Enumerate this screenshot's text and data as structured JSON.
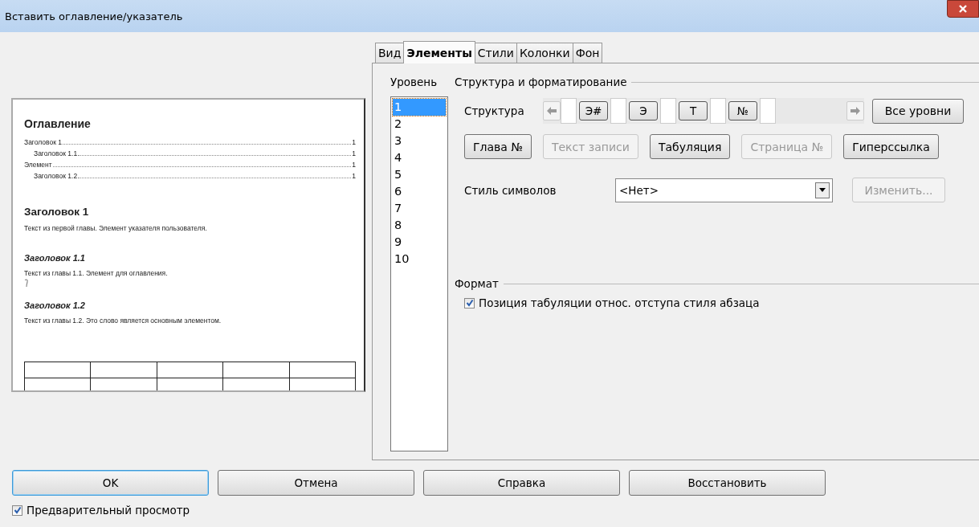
{
  "window": {
    "title": "Вставить оглавление/указатель"
  },
  "preview": {
    "toc_title": "Оглавление",
    "toc_entries": [
      {
        "text": "Заголовок 1",
        "page": "1",
        "children": [
          {
            "text": "Заголовок 1.1",
            "page": "1"
          }
        ]
      },
      {
        "text": "Элемент",
        "page": "1",
        "children": [
          {
            "text": "Заголовок 1.2",
            "page": "1"
          }
        ]
      }
    ],
    "blocks": [
      {
        "kind": "h1",
        "text": "Заголовок 1"
      },
      {
        "kind": "p",
        "text": "Текст из первой главы. Элемент указателя пользователя."
      },
      {
        "kind": "h2",
        "text": "Заголовок 1.1"
      },
      {
        "kind": "p",
        "text": "Текст из главы 1.1. Элемент для оглавления."
      },
      {
        "kind": "mark"
      },
      {
        "kind": "h2",
        "text": "Заголовок 1.2"
      },
      {
        "kind": "p",
        "text": "Текст из главы 1.2. Это слово является основным элементом."
      },
      {
        "kind": "table"
      }
    ]
  },
  "tabs": [
    {
      "label": "Вид",
      "selected": false
    },
    {
      "label": "Элементы",
      "selected": true
    },
    {
      "label": "Стили",
      "selected": false
    },
    {
      "label": "Колонки",
      "selected": false
    },
    {
      "label": "Фон",
      "selected": false
    }
  ],
  "level": {
    "label": "Уровень",
    "items": [
      {
        "label": "1",
        "selected": true
      },
      {
        "label": "2",
        "selected": false
      },
      {
        "label": "3",
        "selected": false
      },
      {
        "label": "4",
        "selected": false
      },
      {
        "label": "5",
        "selected": false
      },
      {
        "label": "6",
        "selected": false
      },
      {
        "label": "7",
        "selected": false
      },
      {
        "label": "8",
        "selected": false
      },
      {
        "label": "9",
        "selected": false
      },
      {
        "label": "10",
        "selected": false
      }
    ]
  },
  "structure": {
    "title": "Структура и форматирование",
    "label": "Структура",
    "tokens": [
      {
        "kind": "slot"
      },
      {
        "kind": "token",
        "text": "Э#"
      },
      {
        "kind": "slot"
      },
      {
        "kind": "token",
        "text": "Э"
      },
      {
        "kind": "slot"
      },
      {
        "kind": "token",
        "text": "Т"
      },
      {
        "kind": "slot"
      },
      {
        "kind": "token",
        "text": "№"
      },
      {
        "kind": "slot"
      }
    ],
    "all_levels": "Все уровни",
    "buttons": [
      {
        "label": "Глава №",
        "disabled": false
      },
      {
        "label": "Текст записи",
        "disabled": true
      },
      {
        "label": "Табуляция",
        "disabled": false
      },
      {
        "label": "Страница №",
        "disabled": true
      },
      {
        "label": "Гиперссылка",
        "disabled": false
      }
    ],
    "char_style_label": "Стиль символов",
    "char_style_value": "<Нет>",
    "edit_button": {
      "label": "Изменить...",
      "disabled": true
    }
  },
  "format": {
    "title": "Формат",
    "option": {
      "label": "Позиция табуляции относ. отступа стиля абзаца",
      "checked": true
    }
  },
  "dialog_buttons": [
    {
      "label": "OK",
      "default": true
    },
    {
      "label": "Отмена",
      "default": false
    },
    {
      "label": "Справка",
      "default": false
    },
    {
      "label": "Восстановить",
      "default": false
    }
  ],
  "preview_option": {
    "label": "Предварительный просмотр",
    "checked": true
  }
}
